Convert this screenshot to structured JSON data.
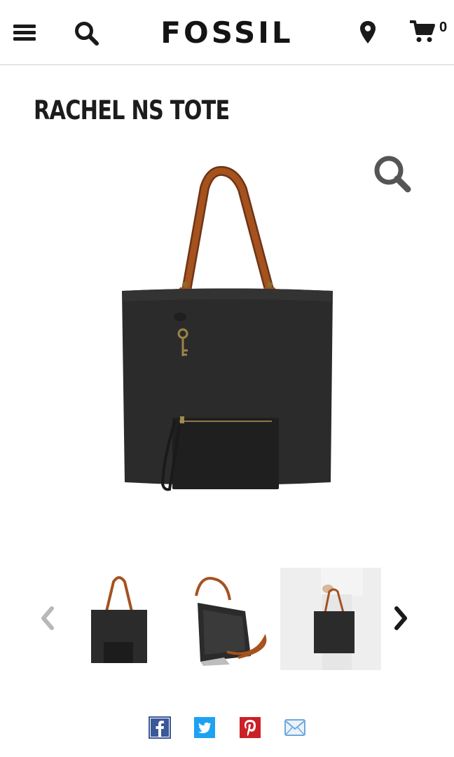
{
  "header": {
    "logo": "FOSSIL",
    "cart_count": "0",
    "icons": [
      "hamburger-menu-icon",
      "search-icon",
      "location-pin-icon",
      "shopping-cart-icon"
    ]
  },
  "product": {
    "title": "RACHEL NS TOTE"
  },
  "gallery": {
    "main_image": "black-tote-with-brown-handles-and-pouch",
    "thumbnails": [
      "tote-front-view",
      "tote-open-interior-view",
      "tote-carried-by-model"
    ],
    "icons": [
      "zoom-magnifier-icon",
      "chevron-left-icon",
      "chevron-right-icon"
    ]
  },
  "share": {
    "icons": [
      "facebook-icon",
      "twitter-icon",
      "pinterest-icon",
      "email-icon"
    ]
  },
  "colors": {
    "bag_black": "#2a2a2a",
    "handle_brown": "#9a4a1c",
    "facebook": "#3b5998",
    "twitter": "#1da1f2",
    "pinterest": "#cb2027",
    "email": "#6fa8dc"
  }
}
